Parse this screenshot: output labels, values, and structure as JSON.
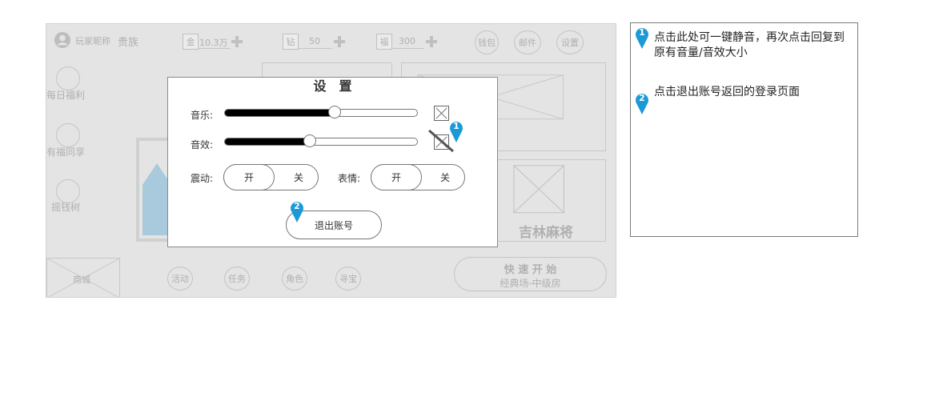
{
  "game": {
    "player_nickname": "玩家昵称",
    "player_rank": "贵族",
    "resources": [
      {
        "icon": "金",
        "value": "10.3万"
      },
      {
        "icon": "钻",
        "value": "50"
      },
      {
        "icon": "福",
        "value": "300"
      }
    ],
    "top_buttons": [
      "钱包",
      "邮件",
      "设置"
    ],
    "side_items": [
      "每日福利",
      "有福同享",
      "摇钱树"
    ],
    "game_card_title": "吉林麻将",
    "bottom": {
      "shop": "商城",
      "buttons": [
        "活动",
        "任务",
        "角色",
        "寻宝"
      ],
      "quick_start_title": "快 速 开 始",
      "quick_start_subtitle": "经典场-中级房"
    }
  },
  "dialog": {
    "title": "设　置",
    "music_label": "音乐:",
    "music_level": 0.57,
    "sfx_label": "音效:",
    "sfx_level": 0.44,
    "vibration_label": "震动:",
    "vibration_on": "开",
    "vibration_off": "关",
    "emote_label": "表情:",
    "emote_on": "开",
    "emote_off": "关",
    "logout_label": "退出账号"
  },
  "markers": {
    "one": "1",
    "two": "2",
    "color": "#1a9ad6"
  },
  "notes": [
    {
      "num": "1",
      "text": "点击此处可一键静音，再次点击回复到原有音量/音效大小"
    },
    {
      "num": "2",
      "text": "点击退出账号返回的登录页面"
    }
  ]
}
